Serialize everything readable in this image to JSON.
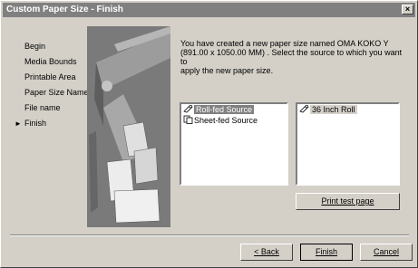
{
  "window": {
    "title": "Custom Paper Size - Finish",
    "close_glyph": "×"
  },
  "steps": [
    {
      "label": "Begin",
      "current": false
    },
    {
      "label": "Media Bounds",
      "current": false
    },
    {
      "label": "Printable Area",
      "current": false
    },
    {
      "label": "Paper Size Name",
      "current": false
    },
    {
      "label": "File name",
      "current": false
    },
    {
      "label": "Finish",
      "current": true
    }
  ],
  "current_marker": "►",
  "description_line1": "You have created a new paper size named OMA KOKO Y",
  "description_line2": "(891.00 x 1050.00 MM) . Select the source to which you want to",
  "description_line3": "apply the new paper size.",
  "sources": [
    {
      "label": "Roll-fed Source",
      "icon": "roll-icon",
      "selected": true
    },
    {
      "label": "Sheet-fed Source",
      "icon": "sheet-icon",
      "selected": false
    }
  ],
  "targets": [
    {
      "label": "36 Inch Roll",
      "icon": "roll-icon",
      "selected": false
    }
  ],
  "buttons": {
    "print_test_page": "Print test page",
    "back": "< Back",
    "finish": "Finish",
    "cancel": "Cancel"
  }
}
